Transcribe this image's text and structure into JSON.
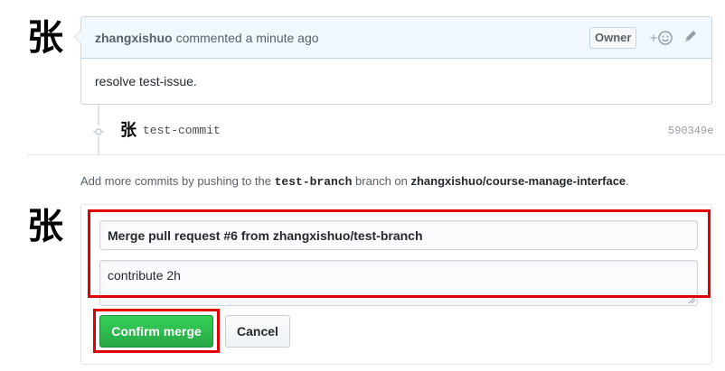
{
  "comment": {
    "avatar_glyph": "张",
    "author": "zhangxishuo",
    "action": "commented a minute ago",
    "badge": "Owner",
    "body": "resolve test-issue.",
    "icons": [
      "add-reaction-icon",
      "pencil-edit-icon"
    ]
  },
  "commit": {
    "avatar_glyph": "张",
    "message": "test-commit",
    "sha": "590349e"
  },
  "info": {
    "prefix": "Add more commits by pushing to the ",
    "branch": "test-branch",
    "middle": " branch on ",
    "repo": "zhangxishuo/course-manage-interface",
    "suffix": "."
  },
  "merge": {
    "avatar_glyph": "张",
    "title_value": "Merge pull request #6 from zhangxishuo/test-branch",
    "message_value": "contribute 2h",
    "confirm_label": "Confirm merge",
    "cancel_label": "Cancel"
  },
  "colors": {
    "highlight": "#e00000",
    "confirm_green": "#2cbe4e",
    "header_blue": "#f1f8ff"
  }
}
